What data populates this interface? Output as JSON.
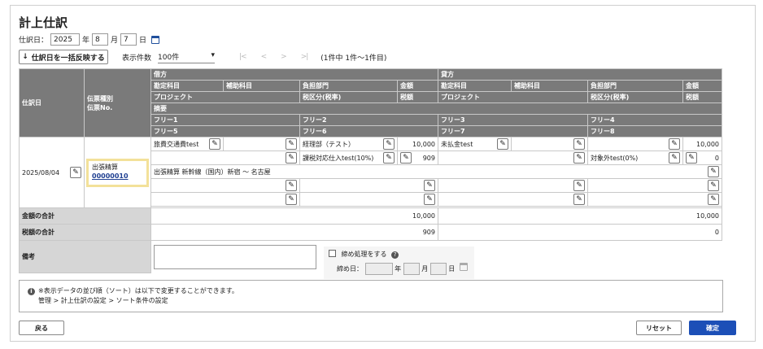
{
  "page": {
    "title": "計上仕訳"
  },
  "date": {
    "label": "仕訳日：",
    "year": "2025",
    "year_unit": "年",
    "month": "8",
    "month_unit": "月",
    "day": "7",
    "day_unit": "日"
  },
  "toolbar": {
    "apply_label": "仕訳日を一括反映する",
    "perpage_label": "表示件数",
    "perpage_value": "100件",
    "pager": [
      "|<",
      "<",
      ">",
      ">|"
    ],
    "page_info": "(1件中 1件～1件目)"
  },
  "table": {
    "h_date": "仕訳日",
    "h_slip": [
      "伝票種別",
      "伝票No."
    ],
    "debit": "借方",
    "credit": "貸方",
    "h_account": "勘定科目",
    "h_sub": "補助科目",
    "h_dept": "負担部門",
    "h_amount": "金額",
    "h_project": "プロジェクト",
    "h_taxcat": "税区分(税率)",
    "h_tax": "税額",
    "h_summary": "摘要",
    "free": [
      "フリー1",
      "フリー2",
      "フリー3",
      "フリー4",
      "フリー5",
      "フリー6",
      "フリー7",
      "フリー8"
    ],
    "row": {
      "date": "2025/08/04",
      "slip_type": "出張精算",
      "slip_no": "00000010",
      "d_account": "旅費交通費test",
      "d_dept": "経理部（テスト）",
      "d_amount": "10,000",
      "d_taxcat": "課税対応仕入test(10%)",
      "d_tax": "909",
      "c_account": "未払金test",
      "c_amount": "10,000",
      "c_taxcat": "対象外test(0%)",
      "c_tax": "0",
      "summary": "出張精算 新幹線（国内）新宿 〜 名古屋"
    },
    "total_amount_label": "金額の合計",
    "total_amount_debit": "10,000",
    "total_amount_credit": "10,000",
    "total_tax_label": "税額の合計",
    "total_tax_debit": "909",
    "total_tax_credit": "0",
    "memo_label": "備考"
  },
  "closing": {
    "label": "締め処理をする",
    "date_label": "締め日：",
    "year_unit": "年",
    "month_unit": "月",
    "day_unit": "日"
  },
  "notice": {
    "line1": "※表示データの並び順（ソート）は以下で変更することができます。",
    "line2": "管理 > 計上仕訳の設定 > ソート条件の設定"
  },
  "footer": {
    "back": "戻る",
    "reset": "リセット",
    "confirm": "確定"
  }
}
